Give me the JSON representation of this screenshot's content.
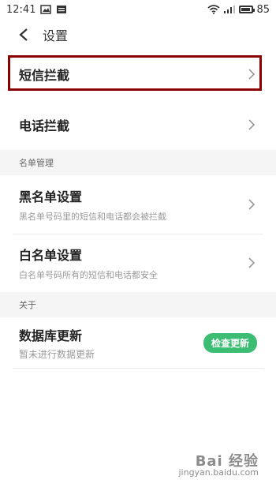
{
  "status_bar": {
    "time": "12:41",
    "battery": "85"
  },
  "header": {
    "title": "设置"
  },
  "rows": {
    "sms_block": {
      "label": "短信拦截"
    },
    "call_block": {
      "label": "电话拦截"
    },
    "blacklist": {
      "label": "黑名单设置",
      "sub": "黑名单号码里的短信和电话都会被拦截"
    },
    "whitelist": {
      "label": "白名单设置",
      "sub": "白名单号码所有的短信和电话都安全"
    },
    "database": {
      "label": "数据库更新",
      "sub": "暂未进行数据更新",
      "button": "检查更新"
    }
  },
  "sections": {
    "list_management": "名单管理",
    "about": "关于"
  },
  "watermark": {
    "brand": "Bai 经验",
    "url": "jingyan.baidu.com"
  },
  "colors": {
    "highlight": "#8b0000",
    "button": "#3cbd73",
    "section_bg": "#f5f5f5"
  }
}
